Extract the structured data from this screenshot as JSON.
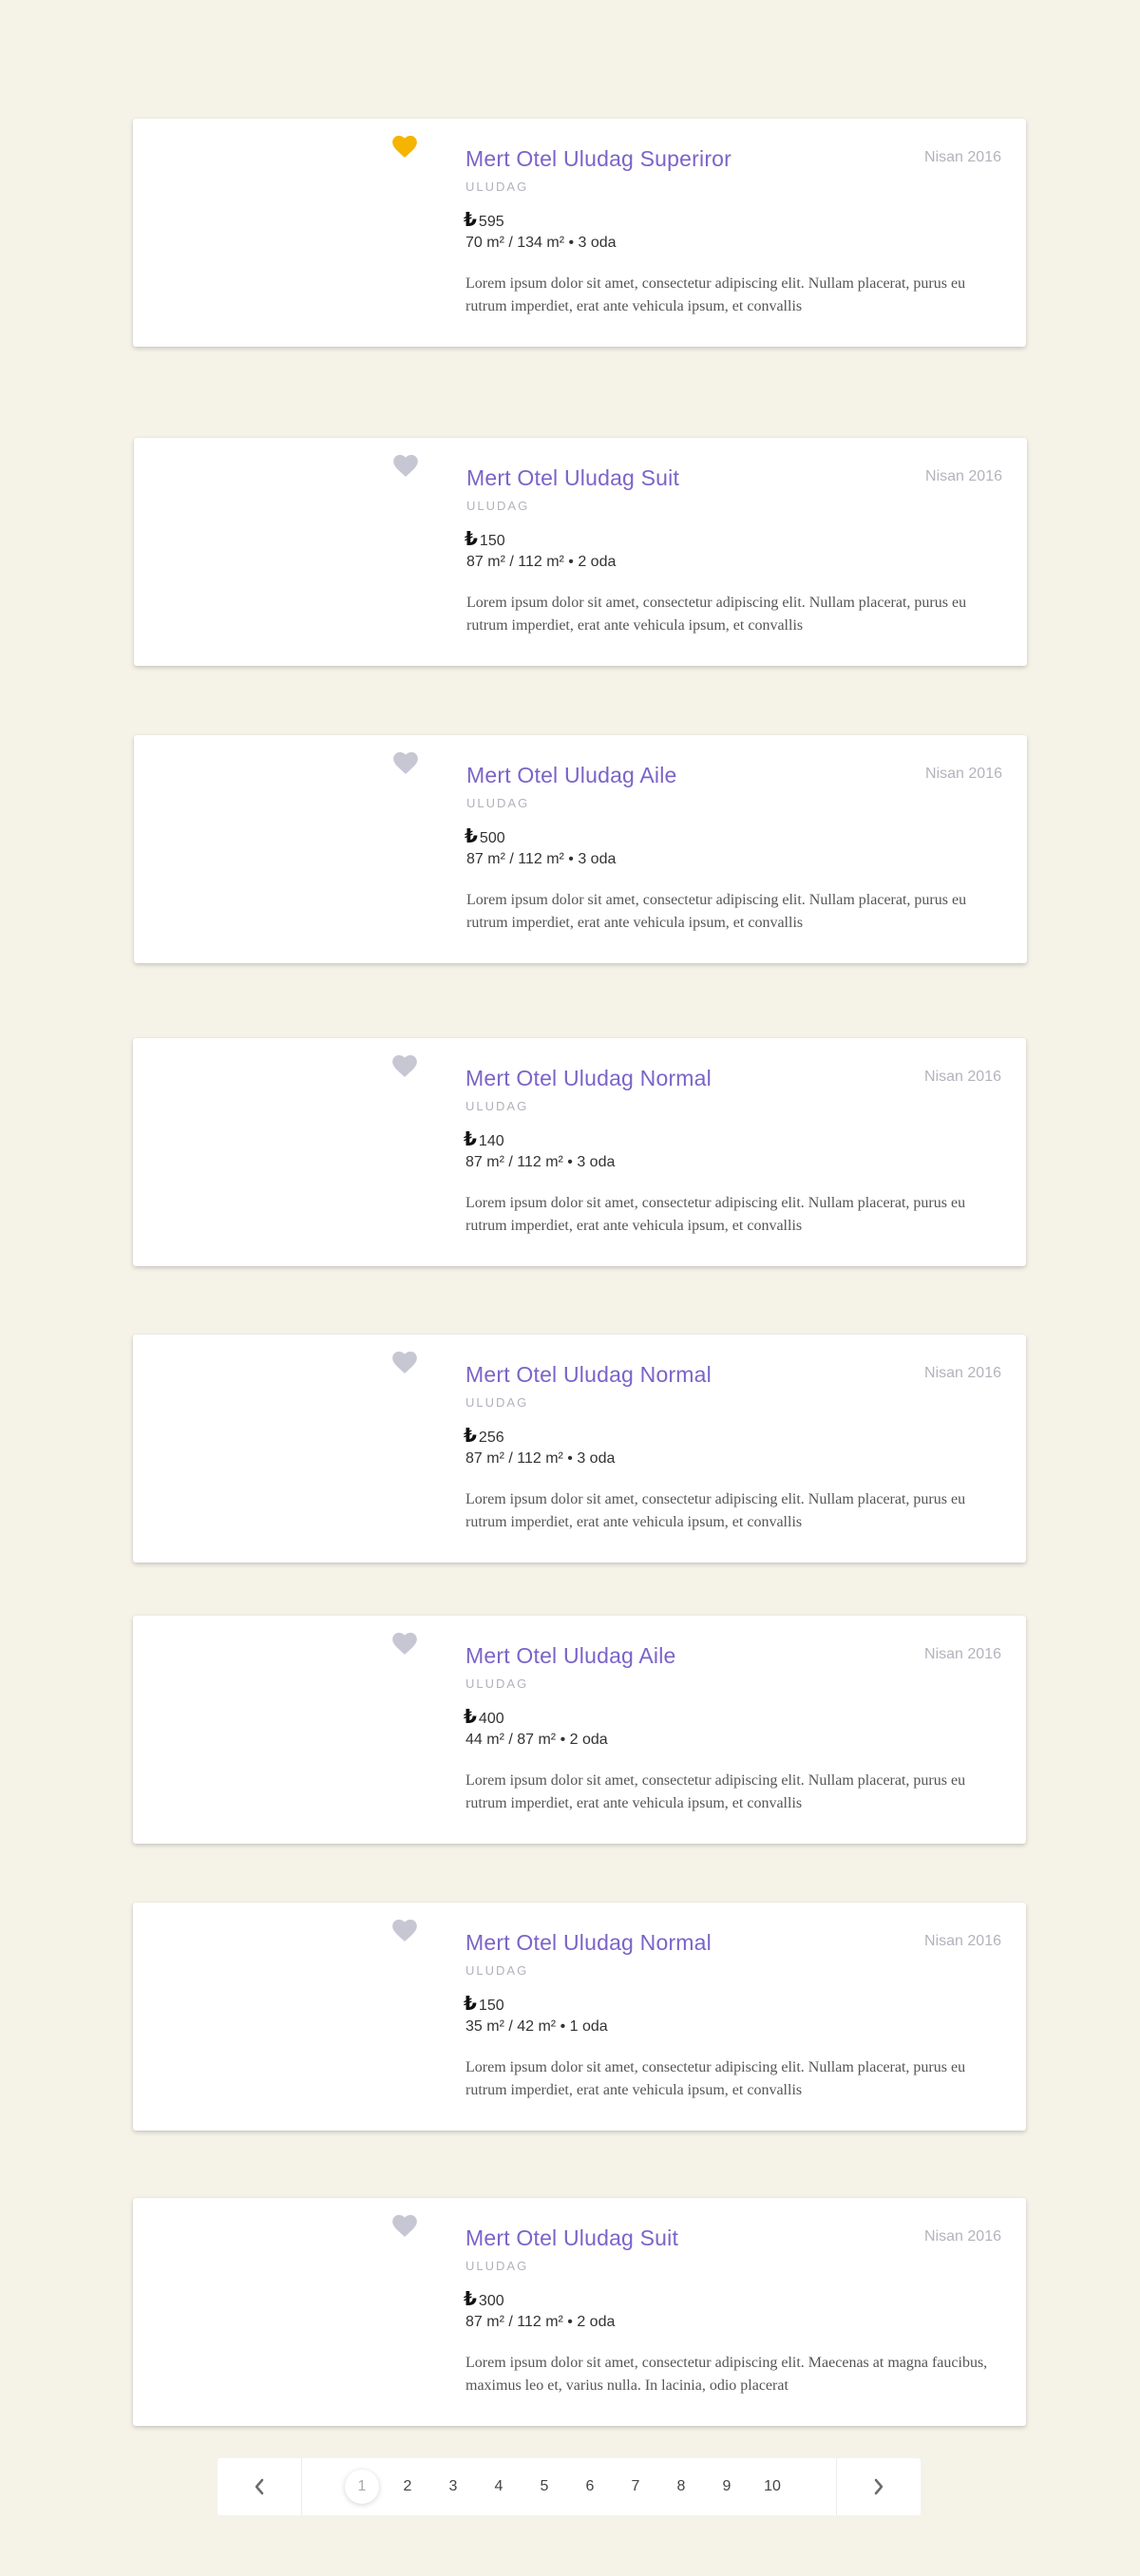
{
  "colors": {
    "background": "#f5f3e8",
    "title": "#7b64c8",
    "favorite_active": "#f5b400",
    "favorite_inactive": "#c7c7d4"
  },
  "listings": [
    {
      "title": "Mert Otel Uludag Superiror",
      "location": "ULUDAG",
      "date": "Nisan 2016",
      "currency": "₺",
      "price": "595",
      "area": "70 m² / 134 m² • 3 oda",
      "favorite": true,
      "icon": "heart-icon",
      "description": "Lorem ipsum dolor sit amet, consectetur adipiscing elit. Nullam placerat, purus eu rutrum imperdiet, erat ante vehicula ipsum, et convallis"
    },
    {
      "title": "Mert Otel Uludag Suit",
      "location": "ULUDAG",
      "date": "Nisan 2016",
      "currency": "₺",
      "price": "150",
      "area": "87 m² / 112 m² • 2 oda",
      "favorite": false,
      "icon": "heart-icon",
      "description": "Lorem ipsum dolor sit amet, consectetur adipiscing elit. Nullam placerat, purus eu rutrum imperdiet, erat ante vehicula ipsum, et convallis"
    },
    {
      "title": "Mert Otel Uludag Aile",
      "location": "ULUDAG",
      "date": "Nisan 2016",
      "currency": "₺",
      "price": "500",
      "area": "87 m² / 112 m² • 3 oda",
      "favorite": false,
      "icon": "heart-icon",
      "description": "Lorem ipsum dolor sit amet, consectetur adipiscing elit. Nullam placerat, purus eu rutrum imperdiet, erat ante vehicula ipsum, et convallis"
    },
    {
      "title": "Mert Otel Uludag Normal",
      "location": "ULUDAG",
      "date": "Nisan 2016",
      "currency": "₺",
      "price": "140",
      "area": "87 m² / 112 m² • 3 oda",
      "favorite": false,
      "icon": "heart-icon",
      "description": "Lorem ipsum dolor sit amet, consectetur adipiscing elit. Nullam placerat, purus eu rutrum imperdiet, erat ante vehicula ipsum, et convallis"
    },
    {
      "title": "Mert Otel Uludag Normal",
      "location": "ULUDAG",
      "date": "Nisan 2016",
      "currency": "₺",
      "price": "256",
      "area": "87 m² / 112 m² • 3 oda",
      "favorite": false,
      "icon": "heart-icon",
      "description": "Lorem ipsum dolor sit amet, consectetur adipiscing elit. Nullam placerat, purus eu rutrum imperdiet, erat ante vehicula ipsum, et convallis"
    },
    {
      "title": "Mert Otel Uludag Aile",
      "location": "ULUDAG",
      "date": "Nisan 2016",
      "currency": "₺",
      "price": "400",
      "area": "44 m² / 87 m² • 2 oda",
      "favorite": false,
      "icon": "heart-icon",
      "description": "Lorem ipsum dolor sit amet, consectetur adipiscing elit. Nullam placerat, purus eu rutrum imperdiet, erat ante vehicula ipsum, et convallis"
    },
    {
      "title": "Mert Otel Uludag Normal",
      "location": "ULUDAG",
      "date": "Nisan 2016",
      "currency": "₺",
      "price": "150",
      "area": "35 m² / 42 m² • 1 oda",
      "favorite": false,
      "icon": "heart-icon",
      "description": "Lorem ipsum dolor sit amet, consectetur adipiscing elit. Nullam placerat, purus eu rutrum imperdiet, erat ante vehicula ipsum, et convallis"
    },
    {
      "title": "Mert Otel Uludag Suit",
      "location": "ULUDAG",
      "date": "Nisan 2016",
      "currency": "₺",
      "price": "300",
      "area": "87 m² / 112 m² • 2 oda",
      "favorite": false,
      "icon": "heart-icon",
      "description": "Lorem ipsum dolor sit amet, consectetur adipiscing elit. Maecenas at magna faucibus, maximus leo et, varius nulla. In lacinia, odio placerat"
    }
  ],
  "pagination": {
    "prev_icon": "chevron-left-icon",
    "next_icon": "chevron-right-icon",
    "current_page": "1",
    "pages": [
      "1",
      "2",
      "3",
      "4",
      "5",
      "6",
      "7",
      "8",
      "9",
      "10"
    ]
  }
}
